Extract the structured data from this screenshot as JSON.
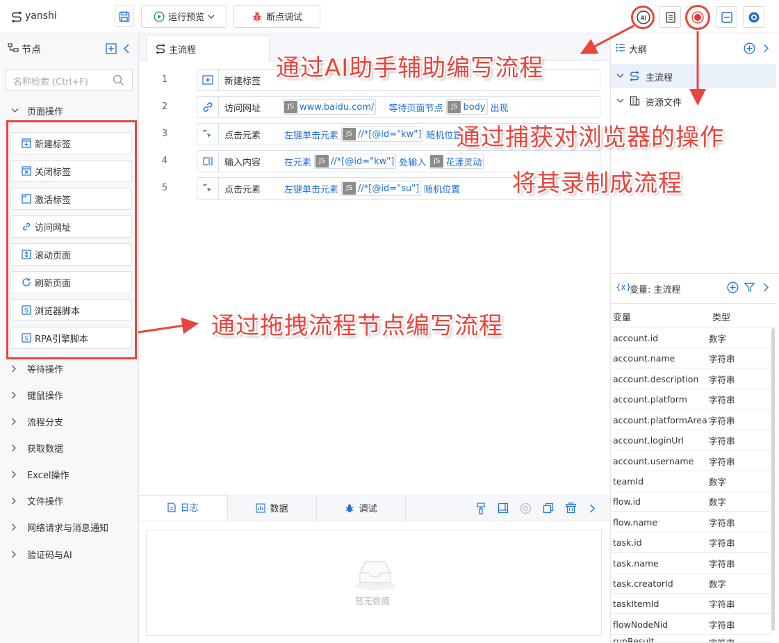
{
  "app": {
    "project_name": "yanshi"
  },
  "toolbar": {
    "run_preview_label": "运行预览",
    "breakpoint_debug_label": "断点调试"
  },
  "left": {
    "title": "节点",
    "search_placeholder": "名称检索 (Ctrl+F)",
    "expanded_category": "页面操作",
    "page_nodes": [
      "新建标签",
      "关闭标签",
      "激活标签",
      "访问网址",
      "滚动页面",
      "刷新页面",
      "浏览器脚本",
      "RPA引擎脚本"
    ],
    "categories": [
      "等待操作",
      "键鼠操作",
      "流程分支",
      "获取数据",
      "Excel操作",
      "文件操作",
      "网络请求与消息通知",
      "验证码与AI"
    ]
  },
  "editor": {
    "tab_label": "主流程",
    "steps": [
      {
        "num": "1",
        "name": "新建标签"
      },
      {
        "num": "2",
        "name": "访问网址",
        "url": "www.baidu.com/",
        "wait_text": "等待页面节点",
        "wait_target": "body",
        "appear": "出现"
      },
      {
        "num": "3",
        "name": "点击元素",
        "action": "左键单击元素",
        "target": "//*[@id=\"kw\"]",
        "position": "随机位置"
      },
      {
        "num": "4",
        "name": "输入内容",
        "prefix": "在元素",
        "target": "//*[@id=\"kw\"]",
        "mid": "处输入",
        "value": "花漾灵动"
      },
      {
        "num": "5",
        "name": "点击元素",
        "action": "左键单击元素",
        "target": "//*[@id=\"su\"]",
        "position": "随机位置"
      }
    ],
    "js_badge": "JS"
  },
  "bottom": {
    "tabs": [
      "日志",
      "数据",
      "调试"
    ],
    "empty_text": "暂无数据"
  },
  "right": {
    "outline_title": "大纲",
    "tree": [
      "主流程",
      "资源文件"
    ],
    "vars_title": "变量: 主流程",
    "col_var": "变量",
    "col_type": "类型",
    "variables": [
      {
        "name": "account.id",
        "type": "数字"
      },
      {
        "name": "account.name",
        "type": "字符串"
      },
      {
        "name": "account.description",
        "type": "字符串"
      },
      {
        "name": "account.platform",
        "type": "字符串"
      },
      {
        "name": "account.platformArea",
        "type": "字符串"
      },
      {
        "name": "account.loginUrl",
        "type": "字符串"
      },
      {
        "name": "account.username",
        "type": "字符串"
      },
      {
        "name": "teamId",
        "type": "数字"
      },
      {
        "name": "flow.id",
        "type": "数字"
      },
      {
        "name": "flow.name",
        "type": "字符串"
      },
      {
        "name": "task.id",
        "type": "字符串"
      },
      {
        "name": "task.name",
        "type": "字符串"
      },
      {
        "name": "task.creatorId",
        "type": "数字"
      },
      {
        "name": "taskItemId",
        "type": "字符串"
      },
      {
        "name": "flowNodeNid",
        "type": "字符串"
      },
      {
        "name": "runResult",
        "type": "字符串"
      }
    ]
  },
  "annotations": {
    "ai": "通过AI助手辅助编写流程",
    "capture_1": "通过捕获对浏览器的操作",
    "capture_2": "将其录制成流程",
    "drag": "通过拖拽流程节点编写流程"
  },
  "colors": {
    "accent": "#1e6fd9",
    "annotation_red": "#e8453c",
    "record_red": "#e53935"
  }
}
